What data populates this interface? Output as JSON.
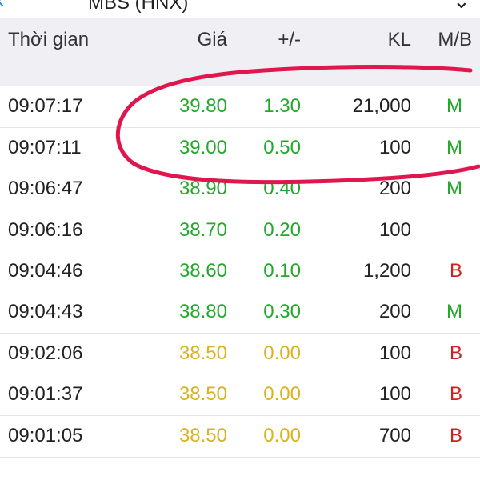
{
  "header": {
    "title": "MBS (HNX)"
  },
  "columns": {
    "time": "Thời gian",
    "price": "Giá",
    "change": "+/-",
    "volume": "KL",
    "side": "M/B"
  },
  "colors": {
    "up": "#22a82a",
    "ref": "#d9b21d",
    "buy": "#22a82a",
    "sell": "#d02020",
    "annotation": "#e0174f"
  },
  "rows": [
    {
      "time": "09:07:17",
      "price": "39.80",
      "change": "1.30",
      "volume": "21,000",
      "side": "M",
      "trend": "up"
    },
    {
      "time": "09:07:11",
      "price": "39.00",
      "change": "0.50",
      "volume": "100",
      "side": "M",
      "trend": "up"
    },
    {
      "time": "09:06:47",
      "price": "38.90",
      "change": "0.40",
      "volume": "200",
      "side": "M",
      "trend": "up"
    },
    {
      "time": "09:06:16",
      "price": "38.70",
      "change": "0.20",
      "volume": "100",
      "side": "",
      "trend": "up"
    },
    {
      "time": "09:04:46",
      "price": "38.60",
      "change": "0.10",
      "volume": "1,200",
      "side": "B",
      "trend": "up"
    },
    {
      "time": "09:04:43",
      "price": "38.80",
      "change": "0.30",
      "volume": "200",
      "side": "M",
      "trend": "up"
    },
    {
      "time": "09:02:06",
      "price": "38.50",
      "change": "0.00",
      "volume": "100",
      "side": "B",
      "trend": "ref"
    },
    {
      "time": "09:01:37",
      "price": "38.50",
      "change": "0.00",
      "volume": "100",
      "side": "B",
      "trend": "ref"
    },
    {
      "time": "09:01:05",
      "price": "38.50",
      "change": "0.00",
      "volume": "700",
      "side": "B",
      "trend": "ref"
    }
  ]
}
